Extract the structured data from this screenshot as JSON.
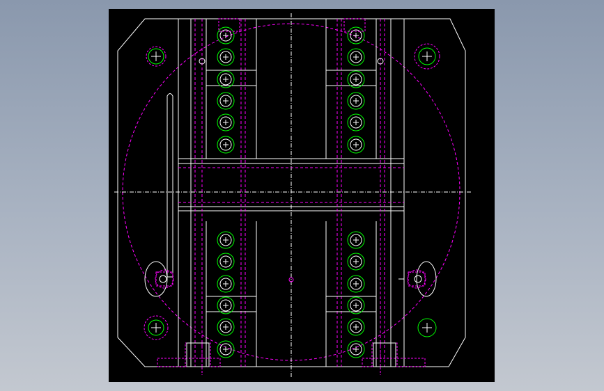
{
  "viewport": {
    "background": "#000000",
    "page_background_top": "#8a98ad",
    "page_background_bottom": "#c3c8d0"
  },
  "palette": {
    "outline": "#ffffff",
    "hidden_line": "#ff00ff",
    "bolt_ring": "#00ff00",
    "centerline": "#ffffff"
  },
  "drawing": {
    "type": "cad-mechanical-plate-top-view",
    "bolt_columns": 4,
    "bolts_per_column_upper": 6,
    "bolts_per_column_lower": 6,
    "corner_holes": 4,
    "side_slots": 2,
    "center_marks": 1
  }
}
